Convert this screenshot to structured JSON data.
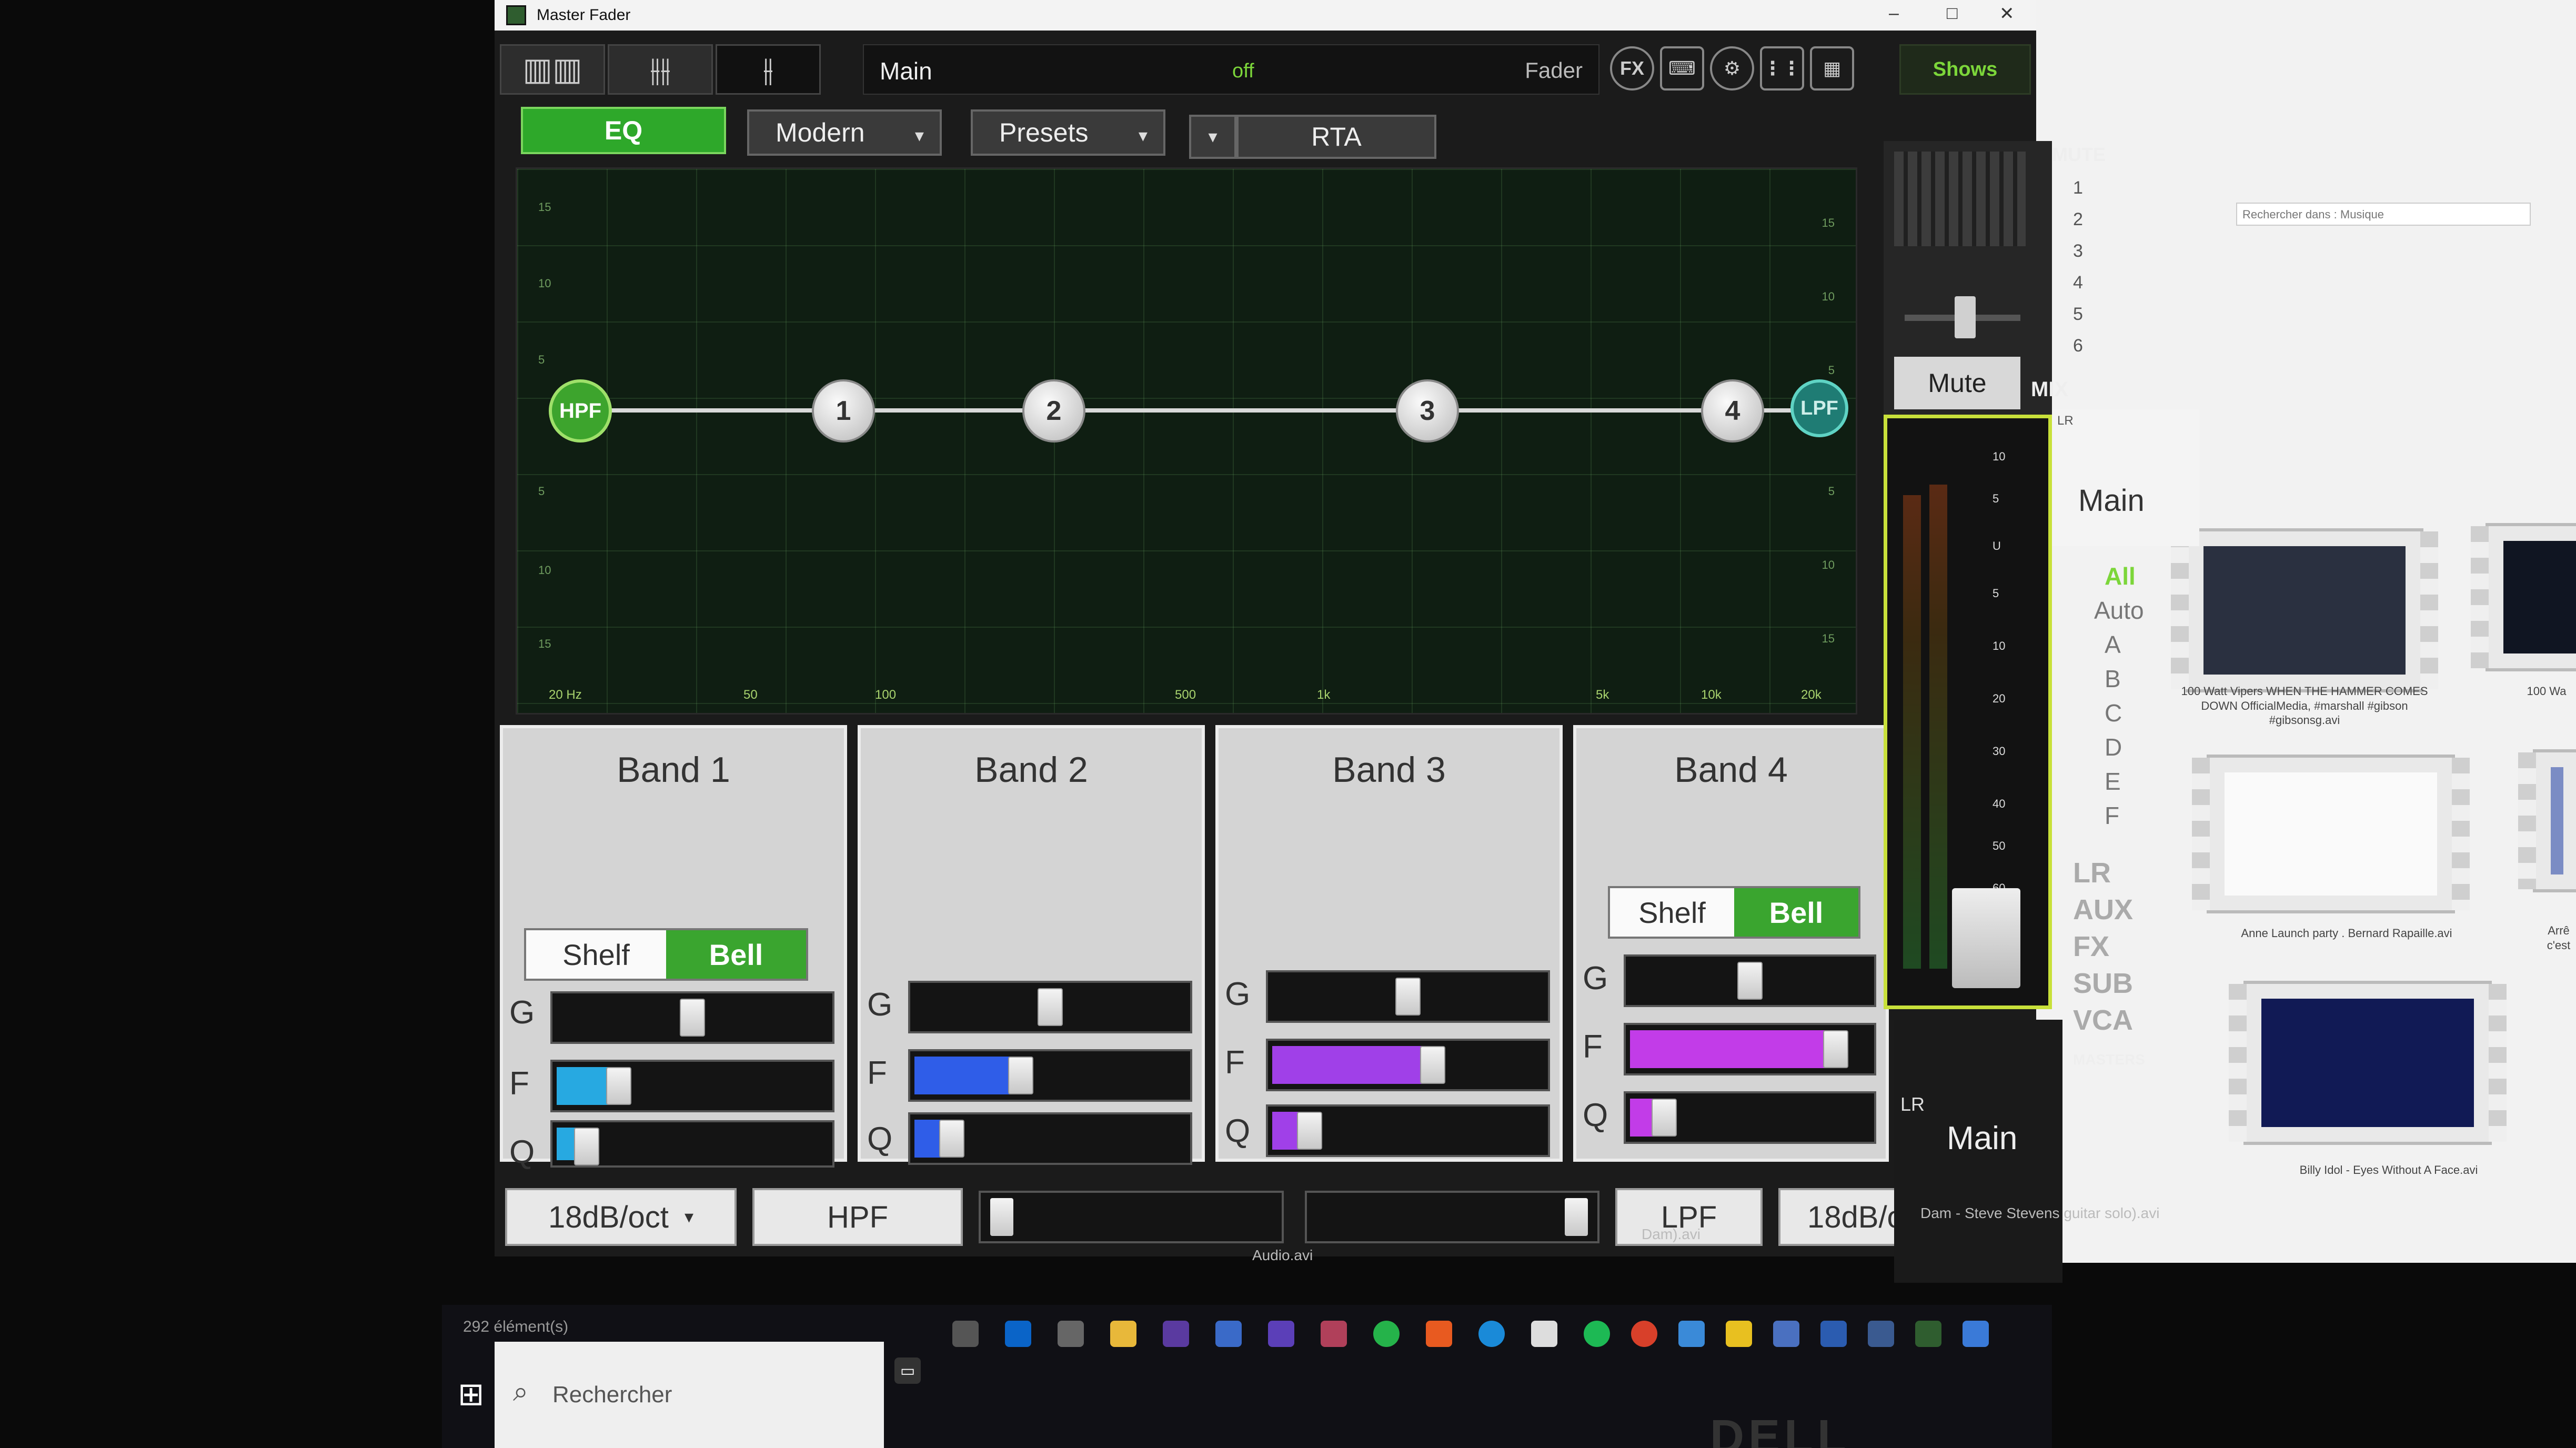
{
  "window": {
    "title": "Master Fader",
    "controls": [
      "–",
      "□",
      "✕"
    ]
  },
  "toolbar": {
    "views": [
      "▥▥",
      "⫲⫲",
      "⫲"
    ],
    "channel_name": "Main",
    "status": "off",
    "fader_label": "Fader",
    "icons": [
      "FX",
      "keyboard-icon",
      "gear-icon",
      "network-icon",
      "grid-icon"
    ],
    "shows_label": "Shows"
  },
  "eq_toolbar": {
    "eq_label": "EQ",
    "mode_label": "Modern",
    "presets_label": "Presets",
    "rta_label": "RTA",
    "caret": "▾"
  },
  "graph": {
    "db_ticks_left": [
      "15",
      "10",
      "5",
      "5",
      "10",
      "15"
    ],
    "db_ticks_right": [
      "15",
      "10",
      "5",
      "5",
      "10",
      "15"
    ],
    "hz_ticks": [
      "20 Hz",
      "50",
      "100",
      "500",
      "1k",
      "5k",
      "10k",
      "20k"
    ],
    "nodes": {
      "hpf": "HPF",
      "b1": "1",
      "b2": "2",
      "b3": "3",
      "b4": "4",
      "lpf": "LPF"
    }
  },
  "bands": [
    {
      "title": "Band 1",
      "shelf": "Shelf",
      "bell": "Bell",
      "g": "G",
      "f": "F",
      "q": "Q",
      "g_level": 0.5,
      "f_level": 0.2,
      "q_level": 0.07
    },
    {
      "title": "Band 2",
      "g": "G",
      "f": "F",
      "q": "Q",
      "g_level": 0.5,
      "f_level": 0.38,
      "q_level": 0.1
    },
    {
      "title": "Band 3",
      "g": "G",
      "f": "F",
      "q": "Q",
      "g_level": 0.5,
      "f_level": 0.6,
      "q_level": 0.1
    },
    {
      "title": "Band 4",
      "shelf": "Shelf",
      "bell": "Bell",
      "g": "G",
      "f": "F",
      "q": "Q",
      "g_level": 0.5,
      "f_level": 0.9,
      "q_level": 0.1
    }
  ],
  "bottom_row": {
    "hpf_slope": "18dB/oct",
    "hpf_label": "HPF",
    "lpf_label": "LPF",
    "lpf_slope": "18dB/oct",
    "hpf_level": 0.02,
    "lpf_level": 0.98
  },
  "strip": {
    "mute_header": "MUTE",
    "mute_numbers": [
      "1",
      "2",
      "3",
      "4",
      "5",
      "6"
    ],
    "mute_button": "Mute",
    "mix_label": "MIX",
    "lr_small": "LR",
    "main_label": "Main",
    "meter_scale": [
      "10",
      "5",
      "U",
      "5",
      "10",
      "20",
      "30",
      "40",
      "50",
      "60"
    ],
    "filters": [
      "All",
      "Auto",
      "A",
      "B",
      "C",
      "D",
      "E",
      "F"
    ],
    "categories": [
      "LR",
      "AUX",
      "FX",
      "SUB",
      "VCA"
    ],
    "masters_label": "MASTERS",
    "bottom_lr": "LR",
    "bottom_main": "Main"
  },
  "explorer": {
    "search_placeholder": "Rechercher dans : Musique",
    "captions": [
      "100 Watt Vipers  WHEN THE HAMMER COMES DOWN OfficialMedia, #marshall #gibson #gibsonsg.avi",
      "100 Wa",
      "Anne Launch party . Bernard Rapaille.avi",
      "Arrê c'est",
      "Billy Idol - Eyes Without A Face.avi"
    ],
    "under_captions": [
      "Audio.avi",
      "Dam).avi",
      "Dam - Steve Stevens guitar solo).avi"
    ],
    "item_count": "292 élément(s)"
  },
  "taskbar": {
    "search_placeholder": "Rechercher"
  },
  "monitor_brand": "DELL"
}
